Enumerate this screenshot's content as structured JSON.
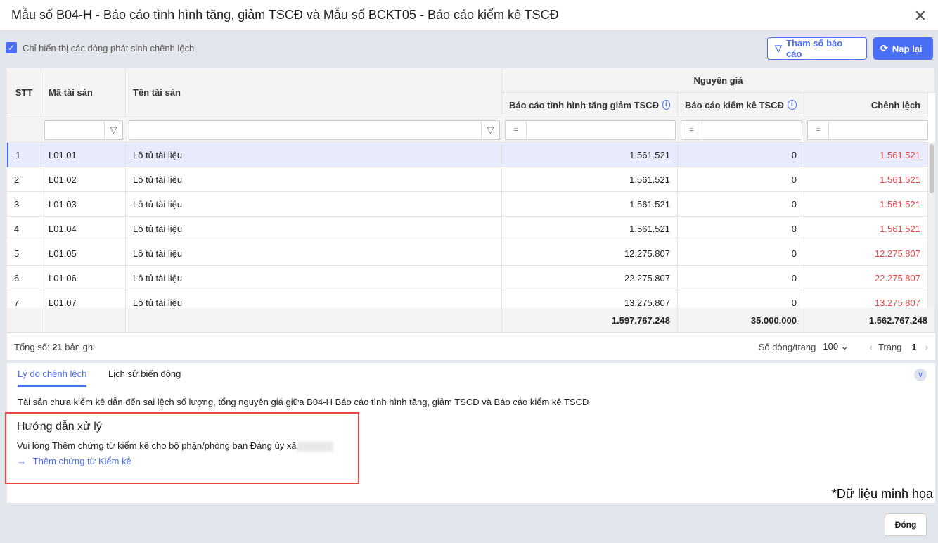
{
  "title": "Mẫu số B04-H - Báo cáo tình hình tăng, giảm TSCĐ và Mẫu số BCKT05 - Báo cáo kiểm kê TSCĐ",
  "toolbar": {
    "checkbox_label": "Chỉ hiển thị các dòng phát sinh chênh lệch",
    "param_label": "Tham số báo cáo",
    "reload_label": "Nạp lại"
  },
  "table": {
    "headers": {
      "stt": "STT",
      "code": "Mã tài sản",
      "name": "Tên tài sản",
      "group": "Nguyên giá",
      "report": "Báo cáo tình hình tăng giảm TSCĐ",
      "inventory": "Báo cáo kiểm kê TSCĐ",
      "diff": "Chênh lệch"
    },
    "filter_eq": "=",
    "rows": [
      {
        "stt": "1",
        "code": "L01.01",
        "name": "Lô tủ tài liệu",
        "report": "1.561.521",
        "inventory": "0",
        "diff": "1.561.521"
      },
      {
        "stt": "2",
        "code": "L01.02",
        "name": "Lô tủ tài liệu",
        "report": "1.561.521",
        "inventory": "0",
        "diff": "1.561.521"
      },
      {
        "stt": "3",
        "code": "L01.03",
        "name": "Lô tủ tài liệu",
        "report": "1.561.521",
        "inventory": "0",
        "diff": "1.561.521"
      },
      {
        "stt": "4",
        "code": "L01.04",
        "name": "Lô tủ tài liệu",
        "report": "1.561.521",
        "inventory": "0",
        "diff": "1.561.521"
      },
      {
        "stt": "5",
        "code": "L01.05",
        "name": "Lô tủ tài liệu",
        "report": "12.275.807",
        "inventory": "0",
        "diff": "12.275.807"
      },
      {
        "stt": "6",
        "code": "L01.06",
        "name": "Lô tủ tài liệu",
        "report": "22.275.807",
        "inventory": "0",
        "diff": "22.275.807"
      },
      {
        "stt": "7",
        "code": "L01.07",
        "name": "Lô tủ tài liệu",
        "report": "13.275.807",
        "inventory": "0",
        "diff": "13.275.807"
      }
    ],
    "totals": {
      "report": "1.597.767.248",
      "inventory": "35.000.000",
      "diff": "1.562.767.248"
    }
  },
  "footer": {
    "total_prefix": "Tổng số: ",
    "total_count": "21",
    "total_suffix": " bản ghi",
    "page_size_label": "Số dòng/trang",
    "page_size": "100",
    "page_label": "Trang",
    "page": "1"
  },
  "panel": {
    "tabs": [
      "Lý do chênh lệch",
      "Lịch sử biến động"
    ],
    "reason": "Tài sản chưa kiểm kê dẫn đến sai lệch số lượng, tổng nguyên giá giữa B04-H Báo cáo tình hình tăng, giảm TSCĐ và Báo cáo kiểm kê TSCĐ",
    "guide_title": "Hướng dẫn xử lý",
    "guide_text": "Vui lòng Thêm chứng từ kiểm kê cho bộ phận/phòng ban Đảng ủy xã",
    "guide_link": "Thêm chứng từ Kiểm kê"
  },
  "watermark": "*Dữ liệu minh họa",
  "close_label": "Đóng"
}
